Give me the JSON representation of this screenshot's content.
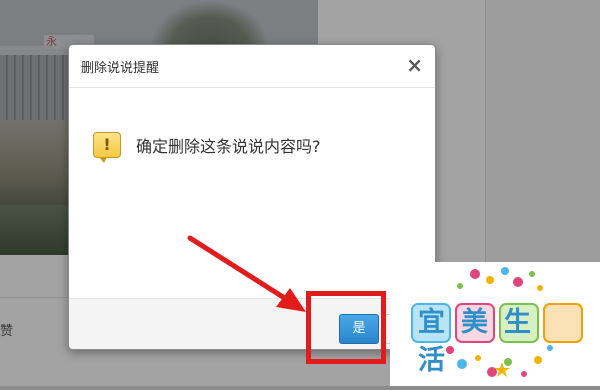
{
  "background": {
    "photo_sign_text": "永",
    "like_text": "赞"
  },
  "dialog": {
    "title": "删除说说提醒",
    "close_glyph": "×",
    "icon_glyph": "!",
    "message": "确定删除这条说说内容吗?",
    "yes_label": "是",
    "no_label": ""
  },
  "annotation": {
    "highlight_color": "#e21c1c"
  },
  "watermark": {
    "text": "宜美生活"
  }
}
